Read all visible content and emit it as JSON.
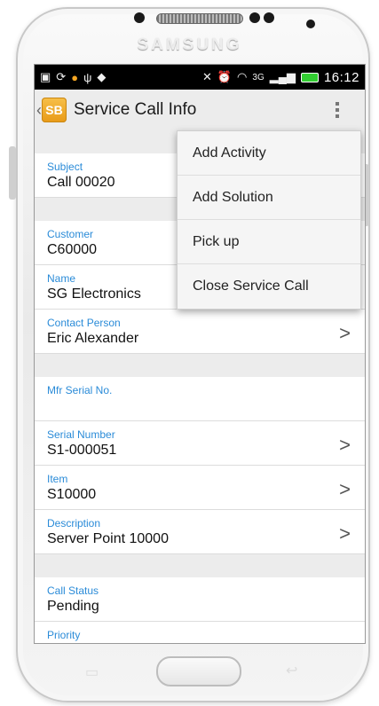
{
  "device": {
    "brand": "SAMSUNG"
  },
  "statusbar": {
    "left_icons": [
      "gallery-icon",
      "sync-icon",
      "notification-icon",
      "usb-icon",
      "game-icon"
    ],
    "right_icons": [
      "mute-icon",
      "alarm-icon",
      "wifi-icon",
      "3g-icon",
      "signal-icon",
      "battery-icon"
    ],
    "network": "3G",
    "time": "16:12"
  },
  "actionbar": {
    "title": "Service Call Info",
    "app_icon_label": "SB"
  },
  "fields": {
    "subject": {
      "label": "Subject",
      "value": "Call 00020"
    },
    "customer": {
      "label": "Customer",
      "value": "C60000"
    },
    "name": {
      "label": "Name",
      "value": "SG Electronics"
    },
    "contact_person": {
      "label": "Contact Person",
      "value": "Eric Alexander"
    },
    "mfr_serial": {
      "label": "Mfr Serial No.",
      "value": ""
    },
    "serial_number": {
      "label": "Serial Number",
      "value": "S1-000051"
    },
    "item": {
      "label": "Item",
      "value": "S10000"
    },
    "description": {
      "label": "Description",
      "value": "Server Point 10000"
    },
    "call_status": {
      "label": "Call Status",
      "value": "Pending"
    },
    "priority": {
      "label": "Priority",
      "value": ""
    }
  },
  "menu": {
    "items": [
      "Add Activity",
      "Add Solution",
      "Pick up",
      "Close Service Call"
    ]
  },
  "colors": {
    "label_blue": "#2a8bd8",
    "app_icon_orange": "#f0a52b"
  }
}
